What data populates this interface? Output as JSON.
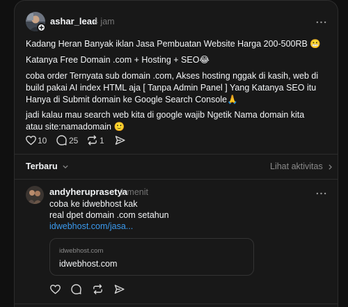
{
  "post": {
    "username": "ashar_lead",
    "time": "4 jam",
    "paragraphs": [
      "Kadang Heran Banyak iklan Jasa Pembuatan Website Harga 200-500RB 😬",
      "Katanya Free Domain .com + Hosting + SEO😂",
      "coba order Ternyata sub domain .com, Akses hosting nggak di kasih, web di build pakai AI index HTML aja [ Tanpa Admin Panel ] Yang Katanya SEO itu Hanya di Submit domain ke Google Search Console🙏",
      "jadi kalau mau search web kita di google wajib Ngetik Nama domain kita atau site:namadomain 🙂"
    ],
    "likes": "10",
    "comments": "25",
    "reposts": "1"
  },
  "replies_bar": {
    "sort_label": "Terbaru",
    "activity_label": "Lihat aktivitas"
  },
  "reply": {
    "username": "andyheruprasetya",
    "time": "1 menit",
    "lines": [
      "coba ke idwebhost kak",
      "real dpet domain .com setahun"
    ],
    "link_text": "idwebhost.com/jasa...",
    "card": {
      "domain": "idwebhost.com",
      "title": "idwebhost.com"
    }
  },
  "icons": [
    "heart-icon",
    "comment-icon",
    "repost-icon",
    "share-icon",
    "more-icon",
    "chevron-down-icon",
    "chevron-right-icon",
    "plus-icon"
  ]
}
